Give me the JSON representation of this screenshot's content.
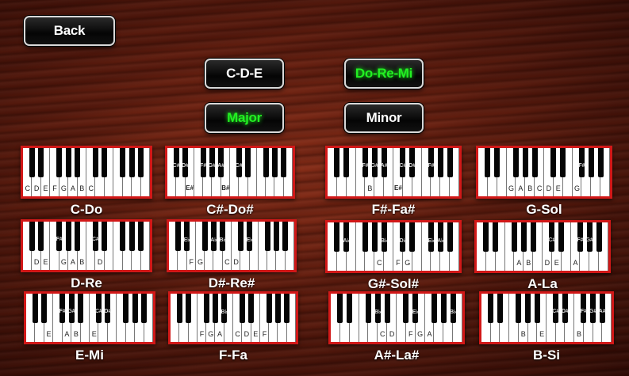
{
  "buttons": {
    "back": "Back",
    "cde": "C-D-E",
    "doremi": "Do-Re-Mi",
    "major": "Major",
    "minor": "Minor"
  },
  "active": [
    "doremi",
    "major"
  ],
  "accent_color": "#22f022",
  "border_color": "#d21818",
  "scales": [
    {
      "name": "C-Do",
      "sharp_labels": [
        "",
        "",
        "",
        "",
        ""
      ],
      "white_labels": [
        "C",
        "D",
        "E",
        "F",
        "G",
        "A",
        "B",
        "C",
        "",
        "",
        "",
        "",
        "",
        ""
      ]
    },
    {
      "name": "C#-Do#",
      "sharp_labels": [
        "C#",
        "D#",
        "F#",
        "G#",
        "A#",
        "C#"
      ],
      "white_labels": [
        "",
        "",
        "E#",
        "",
        "",
        "",
        "B#",
        "",
        "",
        "",
        "",
        "",
        "",
        ""
      ]
    },
    {
      "name": "F#-Fa#",
      "sharp_labels": [
        "F#",
        "G#",
        "A#",
        "C#",
        "D#",
        "F#"
      ],
      "white_labels": [
        "",
        "",
        "",
        "",
        "B",
        "",
        "",
        "E#",
        "",
        "",
        "",
        "",
        "",
        ""
      ]
    },
    {
      "name": "G-Sol",
      "sharp_labels": [
        "F#"
      ],
      "white_labels": [
        "",
        "",
        "",
        "G",
        "A",
        "B",
        "C",
        "D",
        "E",
        "",
        "G",
        "",
        "",
        ""
      ]
    },
    {
      "name": "D-Re",
      "sharp_labels": [
        "F#",
        "C#"
      ],
      "white_labels": [
        "",
        "D",
        "E",
        "",
        "G",
        "A",
        "B",
        "",
        "D",
        "",
        "",
        "",
        "",
        ""
      ]
    },
    {
      "name": "D#-Re#",
      "sharp_labels": [
        "E♭",
        "A♭",
        "B♭",
        "E♭"
      ],
      "white_labels": [
        "",
        "",
        "F",
        "G",
        "",
        "",
        "C",
        "D",
        "",
        "",
        "",
        "",
        "",
        ""
      ]
    },
    {
      "name": "G#-Sol#",
      "sharp_labels": [
        "A♭",
        "B♭",
        "D♭",
        "E♭",
        "A♭"
      ],
      "white_labels": [
        "",
        "",
        "",
        "",
        "",
        "C",
        "",
        "F",
        "G",
        "",
        "",
        "",
        "",
        ""
      ]
    },
    {
      "name": "A-La",
      "sharp_labels": [
        "C#",
        "F#",
        "G#"
      ],
      "white_labels": [
        "",
        "",
        "",
        "",
        "A",
        "B",
        "",
        "D",
        "E",
        "",
        "A",
        "",
        "",
        ""
      ]
    },
    {
      "name": "E-Mi",
      "sharp_labels": [
        "F#",
        "G#",
        "C#",
        "D#"
      ],
      "white_labels": [
        "",
        "",
        "E",
        "",
        "A",
        "B",
        "",
        "E",
        "",
        "",
        "",
        "",
        "",
        ""
      ]
    },
    {
      "name": "F-Fa",
      "sharp_labels": [
        "B♭"
      ],
      "white_labels": [
        "",
        "",
        "",
        "F",
        "G",
        "A",
        "",
        "C",
        "D",
        "E",
        "F",
        "",
        "",
        ""
      ]
    },
    {
      "name": "A#-La#",
      "sharp_labels": [
        "B♭",
        "E♭",
        "B♭"
      ],
      "white_labels": [
        "",
        "",
        "",
        "",
        "",
        "C",
        "D",
        "",
        "F",
        "G",
        "A",
        "",
        "",
        ""
      ]
    },
    {
      "name": "B-Si",
      "sharp_labels": [
        "C#",
        "D#",
        "F#",
        "G#",
        "A#"
      ],
      "white_labels": [
        "",
        "",
        "",
        "",
        "B",
        "",
        "E",
        "",
        "",
        "",
        "B",
        "",
        "",
        ""
      ]
    }
  ]
}
